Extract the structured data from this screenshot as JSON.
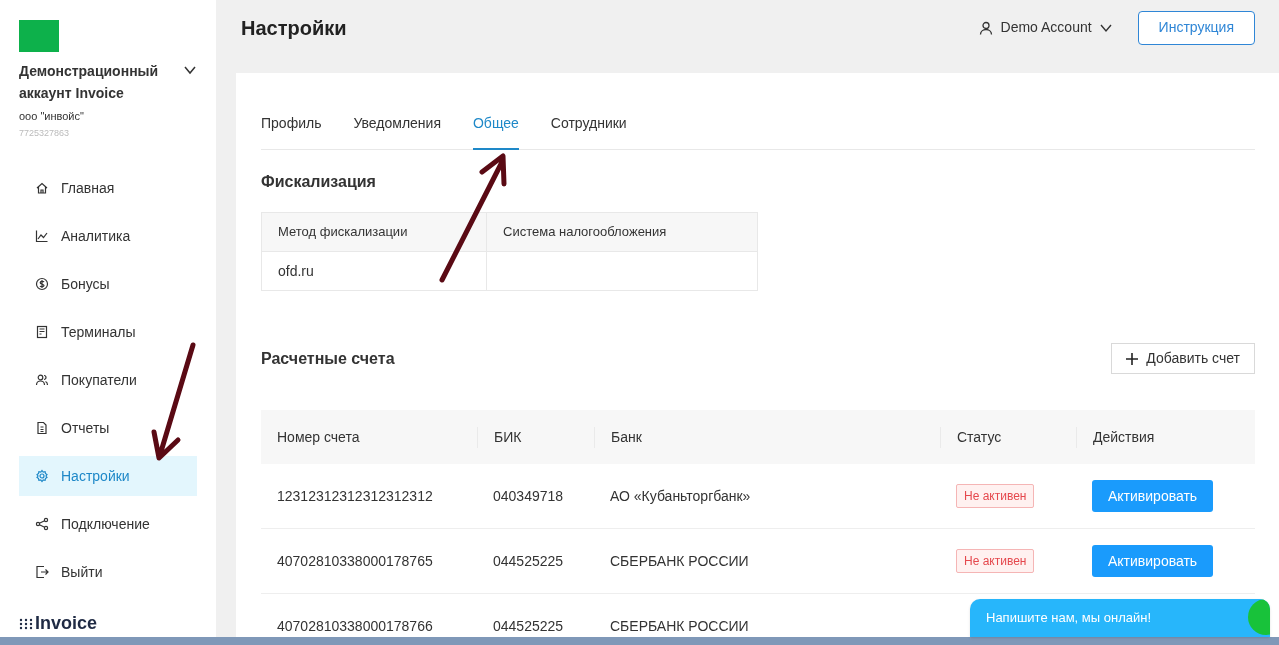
{
  "sidebar": {
    "account_name": "Демонстрационный аккаунт Invoice",
    "company": "ооо \"инвойс\"",
    "inn": "7725327863",
    "items": [
      {
        "kind": "home",
        "label": "Главная",
        "selected": false
      },
      {
        "kind": "chart",
        "label": "Аналитика",
        "selected": false
      },
      {
        "kind": "dollar",
        "label": "Бонусы",
        "selected": false
      },
      {
        "kind": "terminal",
        "label": "Терминалы",
        "selected": false
      },
      {
        "kind": "users",
        "label": "Покупатели",
        "selected": false
      },
      {
        "kind": "report",
        "label": "Отчеты",
        "selected": false
      },
      {
        "kind": "gear",
        "label": "Настройки",
        "selected": true
      },
      {
        "kind": "share",
        "label": "Подключение",
        "selected": false
      },
      {
        "kind": "exit",
        "label": "Выйти",
        "selected": false
      }
    ],
    "logo": "Invoice"
  },
  "header": {
    "title": "Настройки",
    "account": "Demo Account",
    "help_button": "Инструкция"
  },
  "tabs": [
    {
      "label": "Профиль",
      "selected": false
    },
    {
      "label": "Уведомления",
      "selected": false
    },
    {
      "label": "Общее",
      "selected": true
    },
    {
      "label": "Сотрудники",
      "selected": false
    }
  ],
  "fiscal": {
    "title": "Фискализация",
    "columns": [
      "Метод фискализации",
      "Система налогообложения"
    ],
    "rows": [
      [
        "ofd.ru",
        ""
      ]
    ]
  },
  "accounts": {
    "title": "Расчетные счета",
    "add_button": "Добавить счет",
    "columns": [
      "Номер счета",
      "БИК",
      "Банк",
      "Статус",
      "Действия"
    ],
    "rows": [
      {
        "number": "12312312312312312312",
        "bik": "040349718",
        "bank": "АО «Кубаньторгбанк»",
        "status": "Не активен",
        "action": "Активировать"
      },
      {
        "number": "40702810338000178765",
        "bik": "044525225",
        "bank": "СБЕРБАНК РОССИИ",
        "status": "Не активен",
        "action": "Активировать"
      },
      {
        "number": "40702810338000178766",
        "bik": "044525225",
        "bank": "СБЕРБАНК РОССИИ"
      }
    ]
  },
  "chat": {
    "text": "Напишите нам, мы онлайн!"
  }
}
